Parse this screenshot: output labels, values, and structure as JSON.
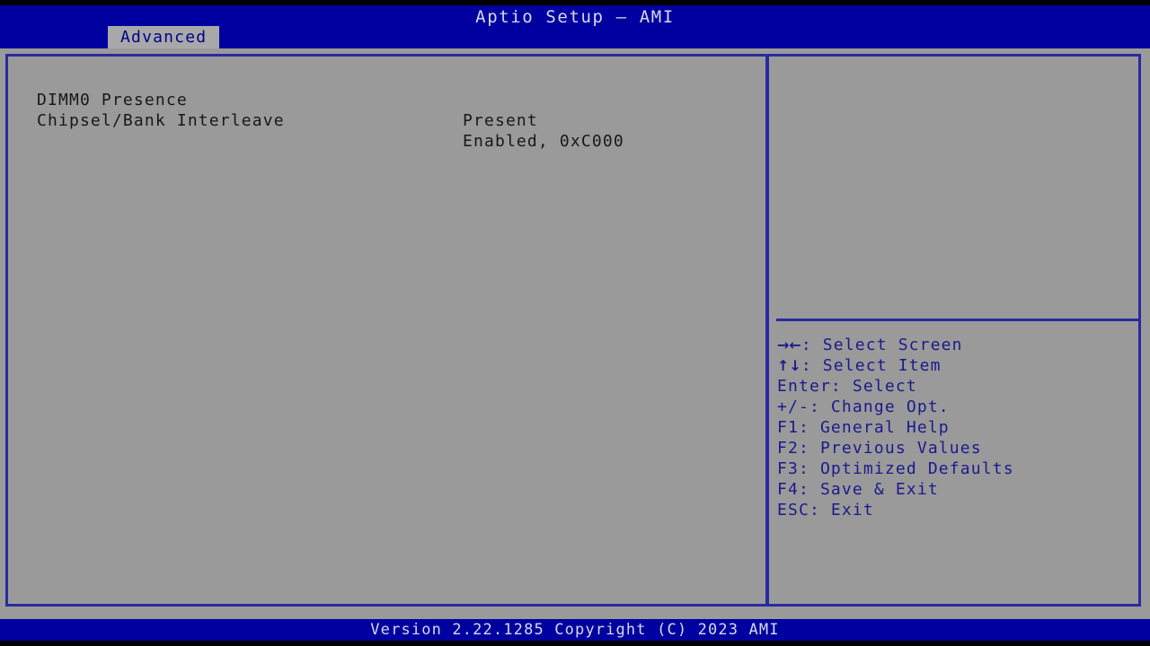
{
  "window": {
    "title": "Aptio Setup – AMI"
  },
  "colors": {
    "header_blue": "#0000a0",
    "panel_gray": "#9a9a9a",
    "border_blue": "#2a2aa0",
    "help_text_blue": "#1a1a8c",
    "tab_active_bg": "#a8a8a8",
    "tab_active_text": "#00008b",
    "body_text": "#181818",
    "header_text": "#d8d8e8"
  },
  "tabs": [
    {
      "label": "Advanced",
      "active": true
    }
  ],
  "settings": [
    {
      "label": "DIMM0 Presence",
      "value": "Present"
    },
    {
      "label": "Chipsel/Bank Interleave",
      "value": "Enabled, 0xC000"
    }
  ],
  "help": {
    "description": "",
    "keys": [
      {
        "glyph": "→←",
        "text": ": Select Screen"
      },
      {
        "glyph": "↑↓",
        "text": ": Select Item"
      },
      {
        "glyph": "",
        "text": "Enter: Select"
      },
      {
        "glyph": "",
        "text": "+/-: Change Opt."
      },
      {
        "glyph": "",
        "text": "F1: General Help"
      },
      {
        "glyph": "",
        "text": "F2: Previous Values"
      },
      {
        "glyph": "",
        "text": "F3: Optimized Defaults"
      },
      {
        "glyph": "",
        "text": "F4: Save & Exit"
      },
      {
        "glyph": "",
        "text": "ESC: Exit"
      }
    ]
  },
  "footer": {
    "version_text": "Version 2.22.1285 Copyright (C) 2023 AMI"
  }
}
